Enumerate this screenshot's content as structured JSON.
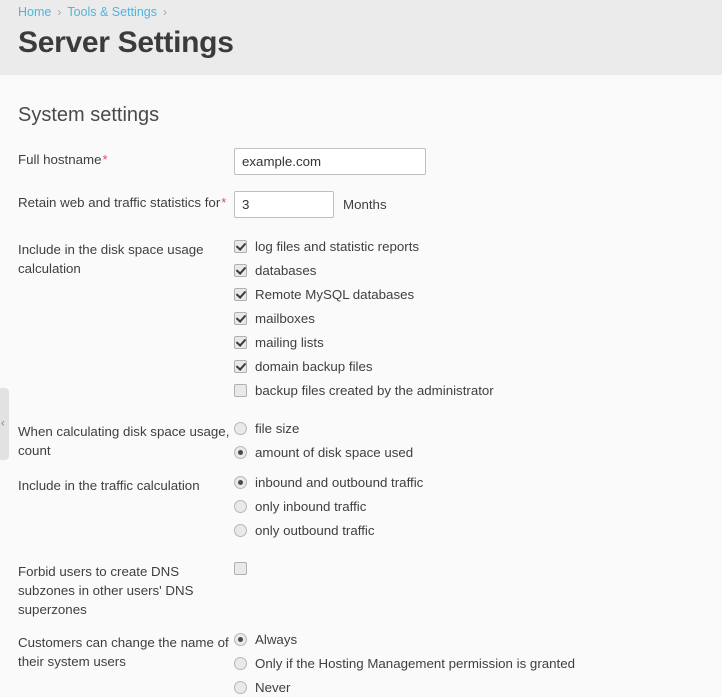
{
  "breadcrumb": {
    "items": [
      {
        "label": "Home"
      },
      {
        "label": "Tools & Settings"
      }
    ],
    "separator": "›"
  },
  "header": {
    "title": "Server Settings"
  },
  "section": {
    "title": "System settings"
  },
  "fields": {
    "hostname": {
      "label": "Full hostname",
      "required_marker": "*",
      "value": "example.com",
      "placeholder": ""
    },
    "retain_stats": {
      "label": "Retain web and traffic statistics for",
      "required_marker": "*",
      "value": "3",
      "unit": "Months",
      "placeholder": ""
    },
    "disk_space_include": {
      "label": "Include in the disk space usage calculation",
      "options": [
        {
          "label": "log files and statistic reports",
          "checked": true
        },
        {
          "label": "databases",
          "checked": true
        },
        {
          "label": "Remote MySQL databases",
          "checked": true
        },
        {
          "label": "mailboxes",
          "checked": true
        },
        {
          "label": "mailing lists",
          "checked": true
        },
        {
          "label": "domain backup files",
          "checked": true
        },
        {
          "label": "backup files created by the administrator",
          "checked": false
        }
      ]
    },
    "disk_space_count": {
      "label": "When calculating disk space usage, count",
      "options": [
        {
          "label": "file size",
          "selected": false
        },
        {
          "label": "amount of disk space used",
          "selected": true
        }
      ]
    },
    "traffic_include": {
      "label": "Include in the traffic calculation",
      "options": [
        {
          "label": "inbound and outbound traffic",
          "selected": true
        },
        {
          "label": "only inbound traffic",
          "selected": false
        },
        {
          "label": "only outbound traffic",
          "selected": false
        }
      ]
    },
    "forbid_dns_subzones": {
      "label": "Forbid users to create DNS subzones in other users' DNS superzones",
      "checked": false
    },
    "customers_rename": {
      "label": "Customers can change the name of their system users",
      "options": [
        {
          "label": "Always",
          "selected": true
        },
        {
          "label": "Only if the Hosting Management permission is granted",
          "selected": false
        },
        {
          "label": "Never",
          "selected": false
        }
      ]
    }
  },
  "collapse_handle": {
    "glyph": "‹"
  },
  "colors": {
    "link": "#4cb6e0",
    "required": "#e0467c",
    "header_bg": "#ebebeb",
    "page_bg": "#fafafa"
  }
}
